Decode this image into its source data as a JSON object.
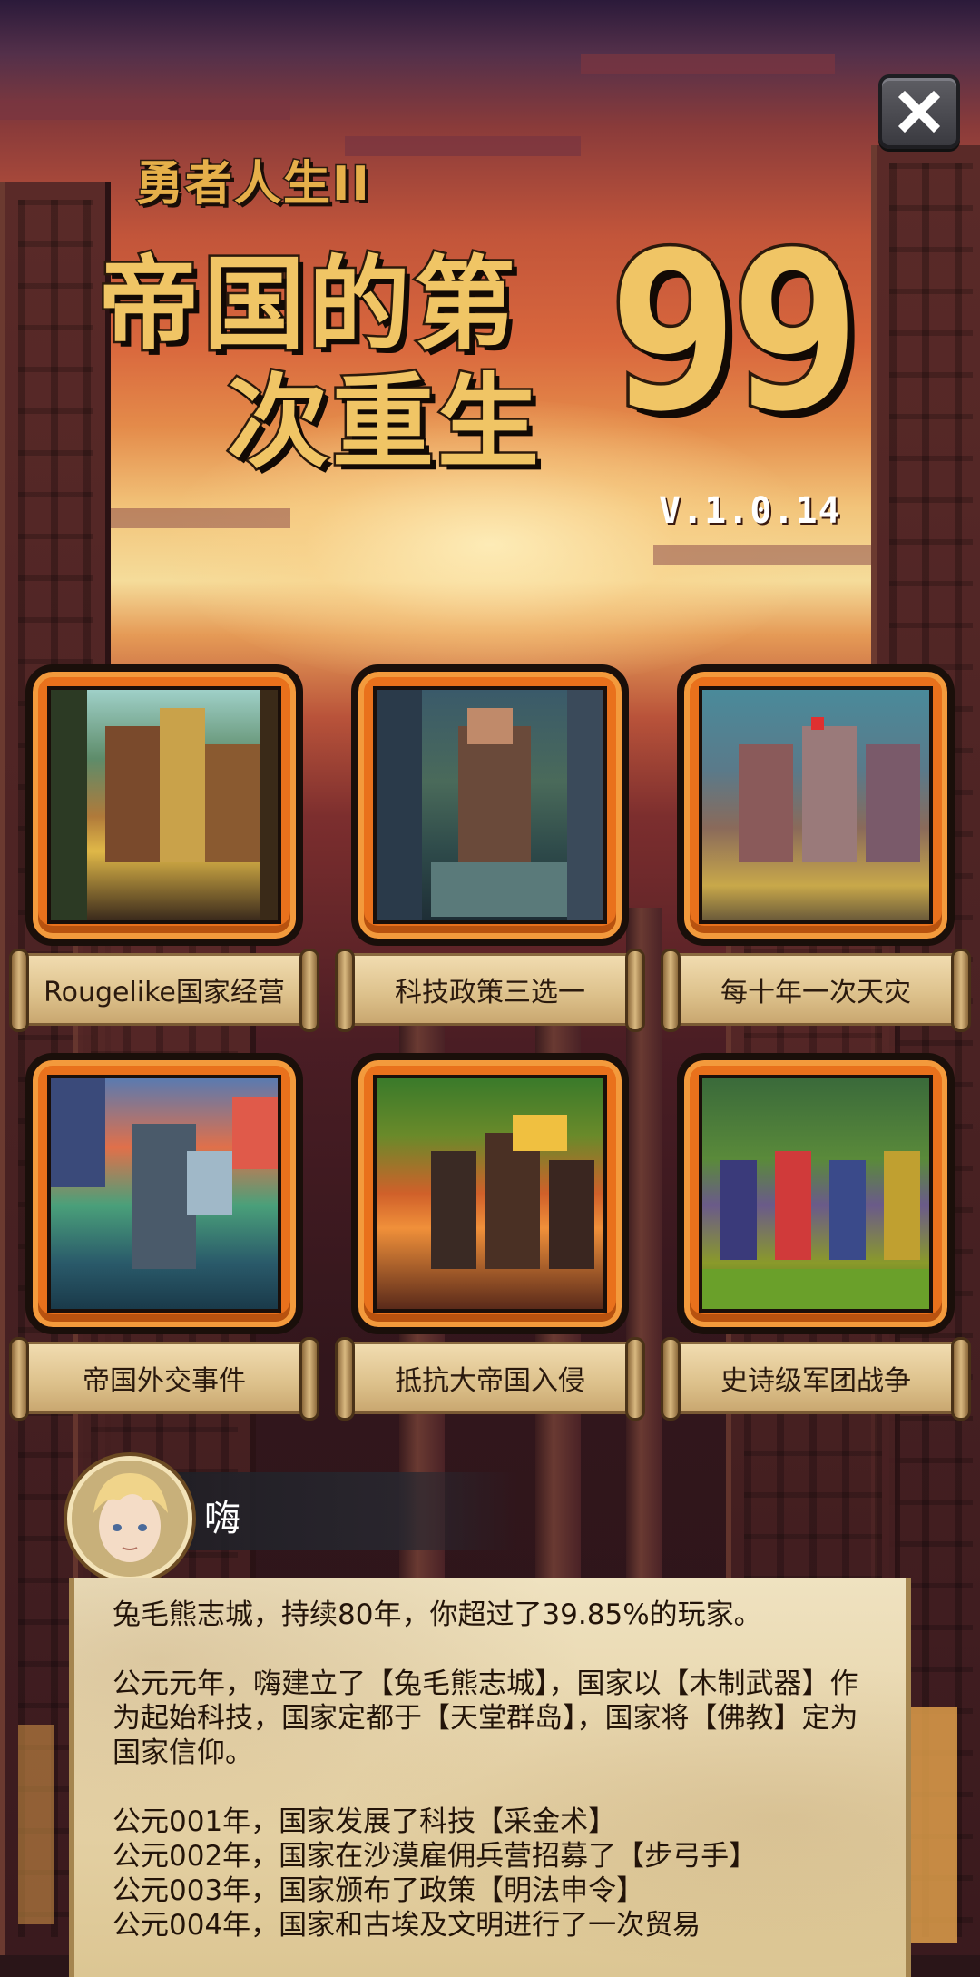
{
  "title": {
    "subtitle": "勇者人生II",
    "line1": "帝国的第",
    "line2": "次重生",
    "number": "99",
    "version": "V.1.0.14"
  },
  "close_button": {
    "icon": "close-icon"
  },
  "features": [
    {
      "label": "Rougelike国家经营",
      "art": "medieval-town"
    },
    {
      "label": "科技政策三选一",
      "art": "knight-statue"
    },
    {
      "label": "每十年一次天灾",
      "art": "charging-soldiers"
    },
    {
      "label": "帝国外交事件",
      "art": "armored-knight"
    },
    {
      "label": "抵抗大帝国入侵",
      "art": "burning-battle"
    },
    {
      "label": "史诗级军团战争",
      "art": "army-march"
    }
  ],
  "speaker": {
    "name": "嗨",
    "avatar": "blond-hero-avatar"
  },
  "log": {
    "summary": "兔毛熊志城，持续80年，你超过了39.85%的玩家。",
    "intro": "公元元年，嗨建立了【兔毛熊志城】，国家以【木制武器】作为起始科技，国家定都于【天堂群岛】，国家将【佛教】定为国家信仰。",
    "entries": [
      "公元001年，国家发展了科技【采金术】",
      "公元002年，国家在沙漠雇佣兵营招募了【步弓手】",
      "公元003年，国家颁布了政策【明法申令】",
      "公元004年，国家和古埃及文明进行了一次贸易"
    ]
  },
  "colors": {
    "title_gold": "#f0c565",
    "frame_orange": "#e9711c",
    "parchment": "#e6d3a8"
  }
}
